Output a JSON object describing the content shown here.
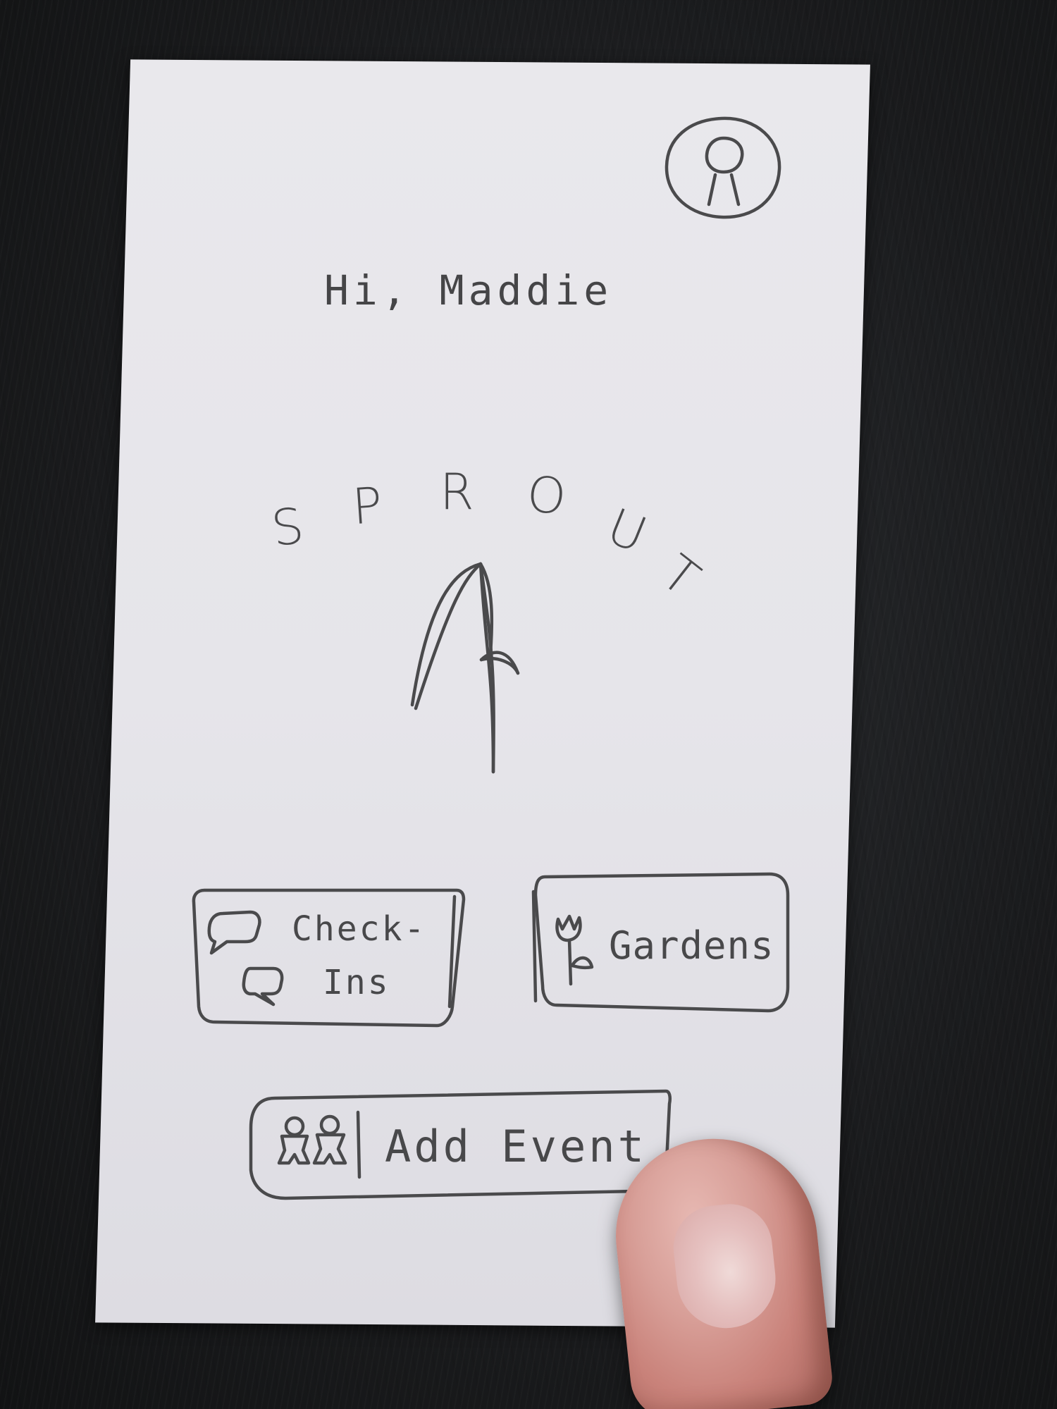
{
  "screen": {
    "greeting": "Hi, Maddie",
    "app_name_letters": [
      "S",
      "P",
      "R",
      "O",
      "U",
      "T"
    ]
  },
  "header": {
    "profile_icon": "profile-avatar-icon"
  },
  "hero": {
    "sprout_icon": "sprout-icon"
  },
  "buttons": {
    "checkins_line1": "Check-",
    "checkins_line2": "Ins",
    "checkins_icon": "chat-bubbles-icon",
    "gardens_label": "Gardens",
    "gardens_icon": "tulip-icon",
    "add_event_label": "Add Event",
    "add_event_icon": "people-icon"
  },
  "colors": {
    "ink": "#4a4a4c",
    "paper": "#e7e6eb",
    "table": "#1c1d1f"
  }
}
